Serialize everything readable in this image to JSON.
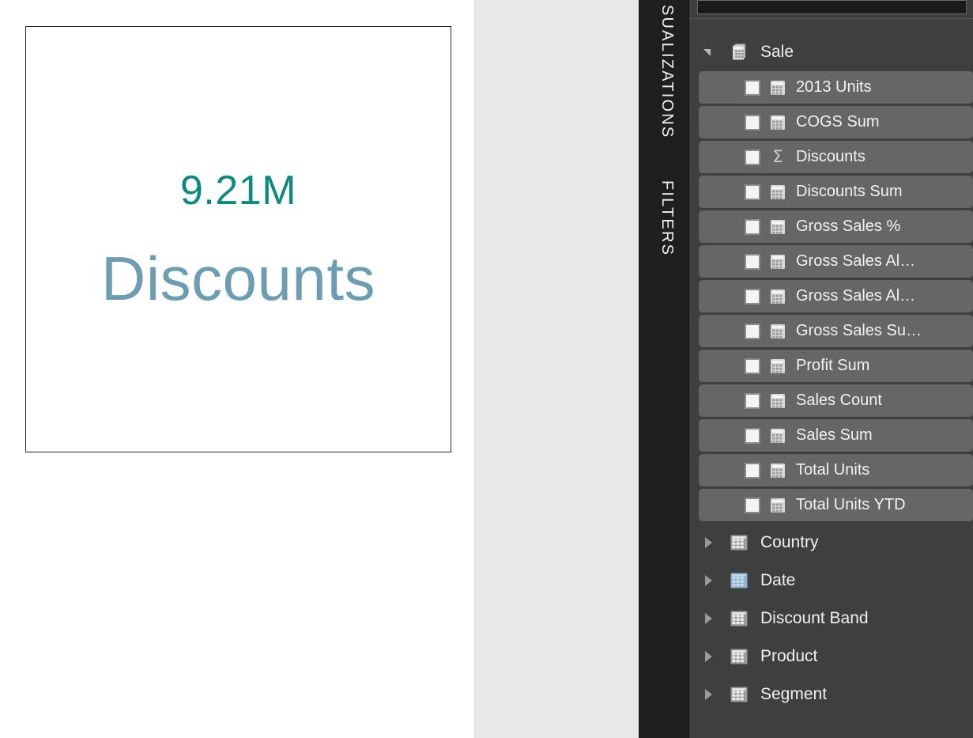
{
  "canvas": {
    "card": {
      "name": "discounts-card",
      "value": "9.21M",
      "label": "Discounts",
      "value_color": "#0d8a7e",
      "label_color": "#6d9db2",
      "border_color": "#262626",
      "background": "#ffffff"
    }
  },
  "rail": {
    "visualizations_label": "SUALIZATIONS",
    "filters_label": "FILTERS",
    "background": "#1f1f1f"
  },
  "fields_pane": {
    "background": "#3f3f3f",
    "row_background": "#666666",
    "search": {
      "value": "",
      "placeholder": ""
    },
    "tables": [
      {
        "name": "Sale",
        "icon": "measure-table-icon",
        "expanded": true,
        "twisty": "triangle-down-icon",
        "fields": [
          {
            "label": "2013 Units",
            "icon": "calculator-icon",
            "checked": false
          },
          {
            "label": "COGS Sum",
            "icon": "calculator-icon",
            "checked": false
          },
          {
            "label": "Discounts",
            "icon": "sigma-icon",
            "checked": false
          },
          {
            "label": "Discounts Sum",
            "icon": "calculator-icon",
            "checked": false
          },
          {
            "label": "Gross Sales %",
            "icon": "calculator-icon",
            "checked": false
          },
          {
            "label": "Gross Sales Al…",
            "icon": "calculator-icon",
            "checked": false
          },
          {
            "label": "Gross Sales Al…",
            "icon": "calculator-icon",
            "checked": false
          },
          {
            "label": "Gross Sales Su…",
            "icon": "calculator-icon",
            "checked": false
          },
          {
            "label": "Profit Sum",
            "icon": "calculator-icon",
            "checked": false
          },
          {
            "label": "Sales Count",
            "icon": "calculator-icon",
            "checked": false
          },
          {
            "label": "Sales Sum",
            "icon": "calculator-icon",
            "checked": false
          },
          {
            "label": "Total Units",
            "icon": "calculator-icon",
            "checked": false
          },
          {
            "label": "Total Units YTD",
            "icon": "calculator-icon",
            "checked": false
          }
        ]
      },
      {
        "name": "Country",
        "icon": "table-icon",
        "expanded": false,
        "twisty": "triangle-right-icon",
        "fields": []
      },
      {
        "name": "Date",
        "icon": "date-table-icon",
        "expanded": false,
        "twisty": "triangle-right-icon",
        "fields": []
      },
      {
        "name": "Discount Band",
        "icon": "table-icon",
        "expanded": false,
        "twisty": "triangle-right-icon",
        "fields": []
      },
      {
        "name": "Product",
        "icon": "table-icon",
        "expanded": false,
        "twisty": "triangle-right-icon",
        "fields": []
      },
      {
        "name": "Segment",
        "icon": "table-icon",
        "expanded": false,
        "twisty": "triangle-right-icon",
        "fields": []
      }
    ]
  }
}
